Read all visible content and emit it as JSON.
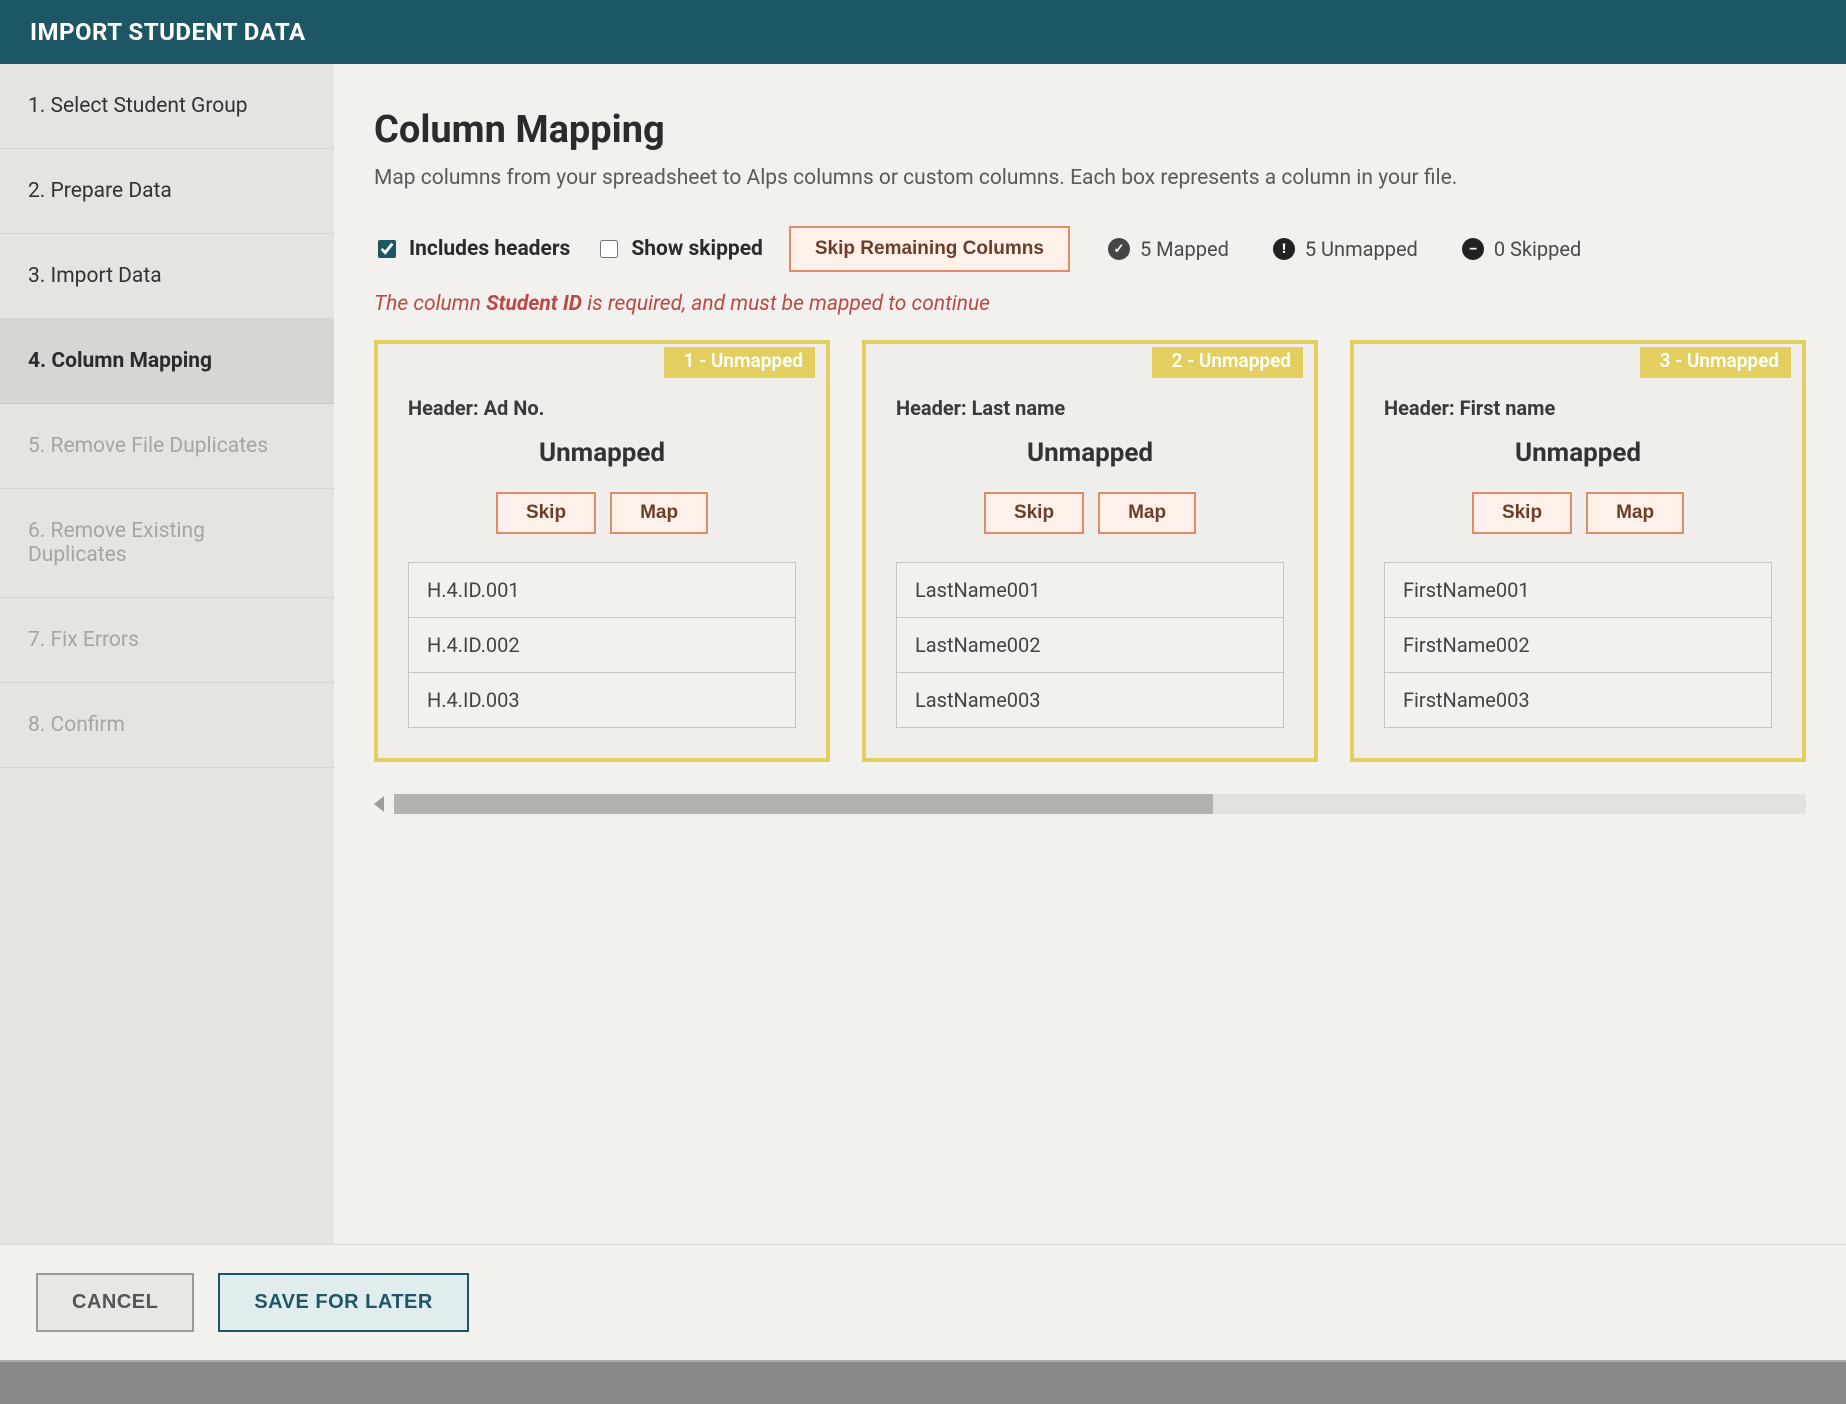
{
  "dialog": {
    "title": "IMPORT STUDENT DATA"
  },
  "steps": {
    "s1": "1. Select Student Group",
    "s2": "2. Prepare Data",
    "s3": "3. Import Data",
    "s4": "4. Column Mapping",
    "s5": "5. Remove File Duplicates",
    "s6": "6. Remove Existing Duplicates",
    "s7": "7. Fix Errors",
    "s8": "8. Confirm"
  },
  "main": {
    "title": "Column Mapping",
    "subtitle": "Map columns from your spreadsheet to Alps columns or custom columns. Each box represents a column in your file.",
    "includes_headers_label": "Includes headers",
    "show_skipped_label": "Show skipped",
    "skip_remaining_label": "Skip Remaining Columns",
    "mapped_text": "5 Mapped",
    "unmapped_text": "5 Unmapped",
    "skipped_text": "0 Skipped",
    "required_prefix": "The column ",
    "required_field": "Student ID",
    "required_suffix": " is required, and must be mapped to continue"
  },
  "cards": {
    "c1": {
      "tag": "1 - Unmapped",
      "header": "Header: Ad No.",
      "status": "Unmapped",
      "skip": "Skip",
      "map": "Map",
      "rows": {
        "r0": "H.4.ID.001",
        "r1": "H.4.ID.002",
        "r2": "H.4.ID.003"
      }
    },
    "c2": {
      "tag": "2 - Unmapped",
      "header": "Header: Last name",
      "status": "Unmapped",
      "skip": "Skip",
      "map": "Map",
      "rows": {
        "r0": "LastName001",
        "r1": "LastName002",
        "r2": "LastName003"
      }
    },
    "c3": {
      "tag": "3 - Unmapped",
      "header": "Header: First name",
      "status": "Unmapped",
      "skip": "Skip",
      "map": "Map",
      "rows": {
        "r0": "FirstName001",
        "r1": "FirstName002",
        "r2": "FirstName003"
      }
    }
  },
  "footer": {
    "cancel": "CANCEL",
    "save": "SAVE FOR LATER"
  }
}
